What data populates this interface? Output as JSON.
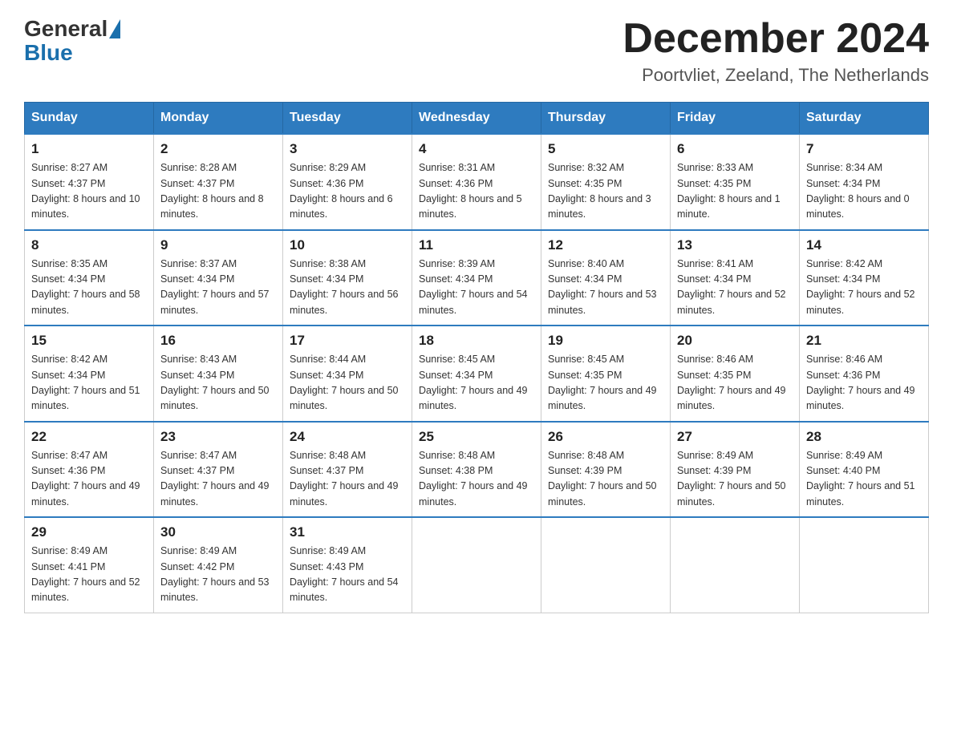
{
  "header": {
    "logo": {
      "text1": "General",
      "text2": "Blue"
    },
    "title": "December 2024",
    "location": "Poortvliet, Zeeland, The Netherlands"
  },
  "days_of_week": [
    "Sunday",
    "Monday",
    "Tuesday",
    "Wednesday",
    "Thursday",
    "Friday",
    "Saturday"
  ],
  "weeks": [
    [
      {
        "day": "1",
        "sunrise": "8:27 AM",
        "sunset": "4:37 PM",
        "daylight": "8 hours and 10 minutes."
      },
      {
        "day": "2",
        "sunrise": "8:28 AM",
        "sunset": "4:37 PM",
        "daylight": "8 hours and 8 minutes."
      },
      {
        "day": "3",
        "sunrise": "8:29 AM",
        "sunset": "4:36 PM",
        "daylight": "8 hours and 6 minutes."
      },
      {
        "day": "4",
        "sunrise": "8:31 AM",
        "sunset": "4:36 PM",
        "daylight": "8 hours and 5 minutes."
      },
      {
        "day": "5",
        "sunrise": "8:32 AM",
        "sunset": "4:35 PM",
        "daylight": "8 hours and 3 minutes."
      },
      {
        "day": "6",
        "sunrise": "8:33 AM",
        "sunset": "4:35 PM",
        "daylight": "8 hours and 1 minute."
      },
      {
        "day": "7",
        "sunrise": "8:34 AM",
        "sunset": "4:34 PM",
        "daylight": "8 hours and 0 minutes."
      }
    ],
    [
      {
        "day": "8",
        "sunrise": "8:35 AM",
        "sunset": "4:34 PM",
        "daylight": "7 hours and 58 minutes."
      },
      {
        "day": "9",
        "sunrise": "8:37 AM",
        "sunset": "4:34 PM",
        "daylight": "7 hours and 57 minutes."
      },
      {
        "day": "10",
        "sunrise": "8:38 AM",
        "sunset": "4:34 PM",
        "daylight": "7 hours and 56 minutes."
      },
      {
        "day": "11",
        "sunrise": "8:39 AM",
        "sunset": "4:34 PM",
        "daylight": "7 hours and 54 minutes."
      },
      {
        "day": "12",
        "sunrise": "8:40 AM",
        "sunset": "4:34 PM",
        "daylight": "7 hours and 53 minutes."
      },
      {
        "day": "13",
        "sunrise": "8:41 AM",
        "sunset": "4:34 PM",
        "daylight": "7 hours and 52 minutes."
      },
      {
        "day": "14",
        "sunrise": "8:42 AM",
        "sunset": "4:34 PM",
        "daylight": "7 hours and 52 minutes."
      }
    ],
    [
      {
        "day": "15",
        "sunrise": "8:42 AM",
        "sunset": "4:34 PM",
        "daylight": "7 hours and 51 minutes."
      },
      {
        "day": "16",
        "sunrise": "8:43 AM",
        "sunset": "4:34 PM",
        "daylight": "7 hours and 50 minutes."
      },
      {
        "day": "17",
        "sunrise": "8:44 AM",
        "sunset": "4:34 PM",
        "daylight": "7 hours and 50 minutes."
      },
      {
        "day": "18",
        "sunrise": "8:45 AM",
        "sunset": "4:34 PM",
        "daylight": "7 hours and 49 minutes."
      },
      {
        "day": "19",
        "sunrise": "8:45 AM",
        "sunset": "4:35 PM",
        "daylight": "7 hours and 49 minutes."
      },
      {
        "day": "20",
        "sunrise": "8:46 AM",
        "sunset": "4:35 PM",
        "daylight": "7 hours and 49 minutes."
      },
      {
        "day": "21",
        "sunrise": "8:46 AM",
        "sunset": "4:36 PM",
        "daylight": "7 hours and 49 minutes."
      }
    ],
    [
      {
        "day": "22",
        "sunrise": "8:47 AM",
        "sunset": "4:36 PM",
        "daylight": "7 hours and 49 minutes."
      },
      {
        "day": "23",
        "sunrise": "8:47 AM",
        "sunset": "4:37 PM",
        "daylight": "7 hours and 49 minutes."
      },
      {
        "day": "24",
        "sunrise": "8:48 AM",
        "sunset": "4:37 PM",
        "daylight": "7 hours and 49 minutes."
      },
      {
        "day": "25",
        "sunrise": "8:48 AM",
        "sunset": "4:38 PM",
        "daylight": "7 hours and 49 minutes."
      },
      {
        "day": "26",
        "sunrise": "8:48 AM",
        "sunset": "4:39 PM",
        "daylight": "7 hours and 50 minutes."
      },
      {
        "day": "27",
        "sunrise": "8:49 AM",
        "sunset": "4:39 PM",
        "daylight": "7 hours and 50 minutes."
      },
      {
        "day": "28",
        "sunrise": "8:49 AM",
        "sunset": "4:40 PM",
        "daylight": "7 hours and 51 minutes."
      }
    ],
    [
      {
        "day": "29",
        "sunrise": "8:49 AM",
        "sunset": "4:41 PM",
        "daylight": "7 hours and 52 minutes."
      },
      {
        "day": "30",
        "sunrise": "8:49 AM",
        "sunset": "4:42 PM",
        "daylight": "7 hours and 53 minutes."
      },
      {
        "day": "31",
        "sunrise": "8:49 AM",
        "sunset": "4:43 PM",
        "daylight": "7 hours and 54 minutes."
      },
      null,
      null,
      null,
      null
    ]
  ]
}
